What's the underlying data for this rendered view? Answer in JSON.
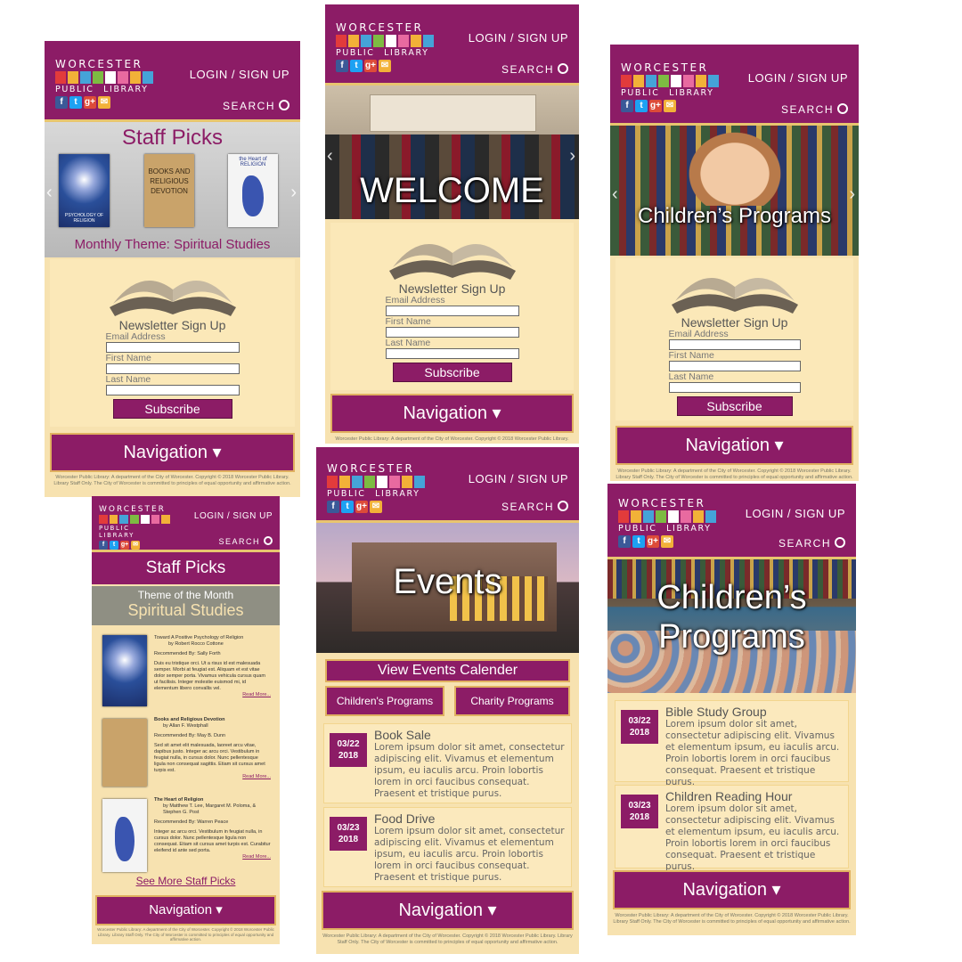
{
  "brand": {
    "logo_top": "WORCESTER",
    "logo_bottom": "PUBLIC LIBRARY",
    "login": "LOGIN / SIGN UP",
    "search": "SEARCH",
    "social": [
      "f",
      "t",
      "g+",
      "✉"
    ],
    "colors": {
      "primary": "#8c1c66",
      "cream": "#f7e2b0",
      "gold": "#e0b060"
    }
  },
  "newsletter": {
    "title": "Newsletter Sign Up",
    "email_label": "Email Address",
    "first_label": "First Name",
    "last_label": "Last Name",
    "subscribe": "Subscribe"
  },
  "nav_label": "Navigation ▾",
  "footer_text": "Worcester Public Library: A department of the City of Worcester. Copyright © 2018 Worcester Public Library. Library Staff Only. The City of Worcester is committed to principles of equal opportunity and affirmative action.",
  "screens": {
    "staff_picks": {
      "hero_title": "Staff Picks",
      "theme": "Monthly Theme: Spiritual Studies",
      "books": [
        "PSYCHOLOGY OF RELIGION",
        "BOOKS AND RELIGIOUS DEVOTION",
        "the Heart of RELIGION"
      ]
    },
    "welcome": {
      "hero_title": "WELCOME"
    },
    "children_hero": {
      "hero_title": "Children’s Programs"
    },
    "staff_list": {
      "header": "Staff Picks",
      "theme_small": "Theme of the Month",
      "theme_big": "Spiritual Studies",
      "picks": [
        {
          "title": "Toward A Positive Psychology of Religion",
          "author": "by Robert Rocco Cottone",
          "rec": "Recommended By: Sally Forth",
          "body": "Duis eu tristique orci. Ut a risus id est malesuada semper. Morbi at feugiat est. Aliquam et est vitae dolor semper porta. Vivamus vehicula cursus quam ut facilisis. Integer molestie euismod mi, id elementum libero convallis vel.",
          "more": "Read More..."
        },
        {
          "title": "Books and Religious Devotion",
          "author": "by Allan F. Westphall",
          "rec": "Recommended By: May B. Dunn",
          "body": "Sed sit amet elit malesuada, laoreet arcu vitae, dapibus justo. Integer ac arcu orci. Vestibulum in feugiat nulla, in cursus dolor. Nunc pellentesque ligula non consequat sagittis. Etiam sit cursus amet turpis est.",
          "more": "Read More..."
        },
        {
          "title": "The Heart of Religion",
          "author": "by Matthew T. Lee, Margaret M. Poloma, & Stephen G. Post",
          "rec": "Recommended By: Warren Peace",
          "body": "Integer ac arcu orci. Vestibulum in feugiat nulla, in cursus dolor. Nunc pellentesque ligula non consequat. Etiam sit cursus amet turpis est. Curabitur eleifend id ante sed porta.",
          "more": "Read More..."
        }
      ],
      "see_more": "See More Staff Picks"
    },
    "events": {
      "hero_title": "Events",
      "view_cal": "View Events Calender",
      "children": "Children's Programs",
      "charity": "Charity Programs",
      "items": [
        {
          "date1": "03/22",
          "date2": "2018",
          "title": "Book Sale",
          "body": "Lorem ipsum dolor sit amet, consectetur adipiscing elit. Vivamus et elementum ipsum, eu iaculis arcu. Proin lobortis lorem in orci faucibus consequat. Praesent et tristique purus."
        },
        {
          "date1": "03/23",
          "date2": "2018",
          "title": "Food Drive",
          "body": "Lorem ipsum dolor sit amet, consectetur adipiscing elit. Vivamus et elementum ipsum, eu iaculis arcu. Proin lobortis lorem in orci faucibus consequat. Praesent et tristique purus."
        }
      ]
    },
    "children_programs": {
      "hero_title_1": "Children’s",
      "hero_title_2": "Programs",
      "items": [
        {
          "date1": "03/22",
          "date2": "2018",
          "title": "Bible Study Group",
          "body": "Lorem ipsum dolor sit amet, consectetur adipiscing elit. Vivamus et elementum ipsum, eu iaculis arcu. Proin lobortis lorem in orci faucibus consequat. Praesent et tristique purus."
        },
        {
          "date1": "03/23",
          "date2": "2018",
          "title": "Children Reading Hour",
          "body": "Lorem ipsum dolor sit amet, consectetur adipiscing elit. Vivamus et elementum ipsum, eu iaculis arcu. Proin lobortis lorem in orci faucibus consequat. Praesent et tristique purus."
        }
      ]
    }
  }
}
